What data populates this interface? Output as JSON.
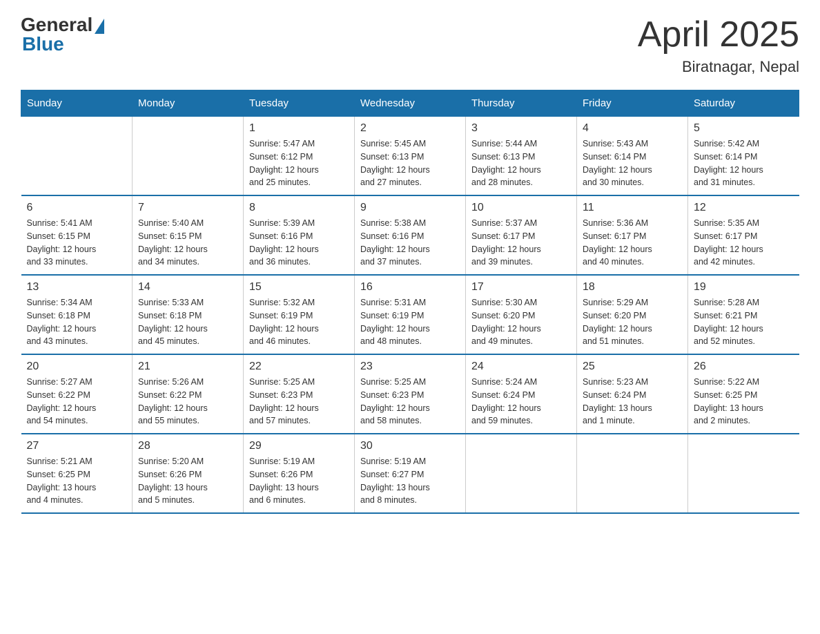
{
  "header": {
    "logo_general": "General",
    "logo_blue": "Blue",
    "title": "April 2025",
    "subtitle": "Biratnagar, Nepal"
  },
  "days_of_week": [
    "Sunday",
    "Monday",
    "Tuesday",
    "Wednesday",
    "Thursday",
    "Friday",
    "Saturday"
  ],
  "weeks": [
    [
      {
        "day": "",
        "info": ""
      },
      {
        "day": "",
        "info": ""
      },
      {
        "day": "1",
        "info": "Sunrise: 5:47 AM\nSunset: 6:12 PM\nDaylight: 12 hours\nand 25 minutes."
      },
      {
        "day": "2",
        "info": "Sunrise: 5:45 AM\nSunset: 6:13 PM\nDaylight: 12 hours\nand 27 minutes."
      },
      {
        "day": "3",
        "info": "Sunrise: 5:44 AM\nSunset: 6:13 PM\nDaylight: 12 hours\nand 28 minutes."
      },
      {
        "day": "4",
        "info": "Sunrise: 5:43 AM\nSunset: 6:14 PM\nDaylight: 12 hours\nand 30 minutes."
      },
      {
        "day": "5",
        "info": "Sunrise: 5:42 AM\nSunset: 6:14 PM\nDaylight: 12 hours\nand 31 minutes."
      }
    ],
    [
      {
        "day": "6",
        "info": "Sunrise: 5:41 AM\nSunset: 6:15 PM\nDaylight: 12 hours\nand 33 minutes."
      },
      {
        "day": "7",
        "info": "Sunrise: 5:40 AM\nSunset: 6:15 PM\nDaylight: 12 hours\nand 34 minutes."
      },
      {
        "day": "8",
        "info": "Sunrise: 5:39 AM\nSunset: 6:16 PM\nDaylight: 12 hours\nand 36 minutes."
      },
      {
        "day": "9",
        "info": "Sunrise: 5:38 AM\nSunset: 6:16 PM\nDaylight: 12 hours\nand 37 minutes."
      },
      {
        "day": "10",
        "info": "Sunrise: 5:37 AM\nSunset: 6:17 PM\nDaylight: 12 hours\nand 39 minutes."
      },
      {
        "day": "11",
        "info": "Sunrise: 5:36 AM\nSunset: 6:17 PM\nDaylight: 12 hours\nand 40 minutes."
      },
      {
        "day": "12",
        "info": "Sunrise: 5:35 AM\nSunset: 6:17 PM\nDaylight: 12 hours\nand 42 minutes."
      }
    ],
    [
      {
        "day": "13",
        "info": "Sunrise: 5:34 AM\nSunset: 6:18 PM\nDaylight: 12 hours\nand 43 minutes."
      },
      {
        "day": "14",
        "info": "Sunrise: 5:33 AM\nSunset: 6:18 PM\nDaylight: 12 hours\nand 45 minutes."
      },
      {
        "day": "15",
        "info": "Sunrise: 5:32 AM\nSunset: 6:19 PM\nDaylight: 12 hours\nand 46 minutes."
      },
      {
        "day": "16",
        "info": "Sunrise: 5:31 AM\nSunset: 6:19 PM\nDaylight: 12 hours\nand 48 minutes."
      },
      {
        "day": "17",
        "info": "Sunrise: 5:30 AM\nSunset: 6:20 PM\nDaylight: 12 hours\nand 49 minutes."
      },
      {
        "day": "18",
        "info": "Sunrise: 5:29 AM\nSunset: 6:20 PM\nDaylight: 12 hours\nand 51 minutes."
      },
      {
        "day": "19",
        "info": "Sunrise: 5:28 AM\nSunset: 6:21 PM\nDaylight: 12 hours\nand 52 minutes."
      }
    ],
    [
      {
        "day": "20",
        "info": "Sunrise: 5:27 AM\nSunset: 6:22 PM\nDaylight: 12 hours\nand 54 minutes."
      },
      {
        "day": "21",
        "info": "Sunrise: 5:26 AM\nSunset: 6:22 PM\nDaylight: 12 hours\nand 55 minutes."
      },
      {
        "day": "22",
        "info": "Sunrise: 5:25 AM\nSunset: 6:23 PM\nDaylight: 12 hours\nand 57 minutes."
      },
      {
        "day": "23",
        "info": "Sunrise: 5:25 AM\nSunset: 6:23 PM\nDaylight: 12 hours\nand 58 minutes."
      },
      {
        "day": "24",
        "info": "Sunrise: 5:24 AM\nSunset: 6:24 PM\nDaylight: 12 hours\nand 59 minutes."
      },
      {
        "day": "25",
        "info": "Sunrise: 5:23 AM\nSunset: 6:24 PM\nDaylight: 13 hours\nand 1 minute."
      },
      {
        "day": "26",
        "info": "Sunrise: 5:22 AM\nSunset: 6:25 PM\nDaylight: 13 hours\nand 2 minutes."
      }
    ],
    [
      {
        "day": "27",
        "info": "Sunrise: 5:21 AM\nSunset: 6:25 PM\nDaylight: 13 hours\nand 4 minutes."
      },
      {
        "day": "28",
        "info": "Sunrise: 5:20 AM\nSunset: 6:26 PM\nDaylight: 13 hours\nand 5 minutes."
      },
      {
        "day": "29",
        "info": "Sunrise: 5:19 AM\nSunset: 6:26 PM\nDaylight: 13 hours\nand 6 minutes."
      },
      {
        "day": "30",
        "info": "Sunrise: 5:19 AM\nSunset: 6:27 PM\nDaylight: 13 hours\nand 8 minutes."
      },
      {
        "day": "",
        "info": ""
      },
      {
        "day": "",
        "info": ""
      },
      {
        "day": "",
        "info": ""
      }
    ]
  ]
}
